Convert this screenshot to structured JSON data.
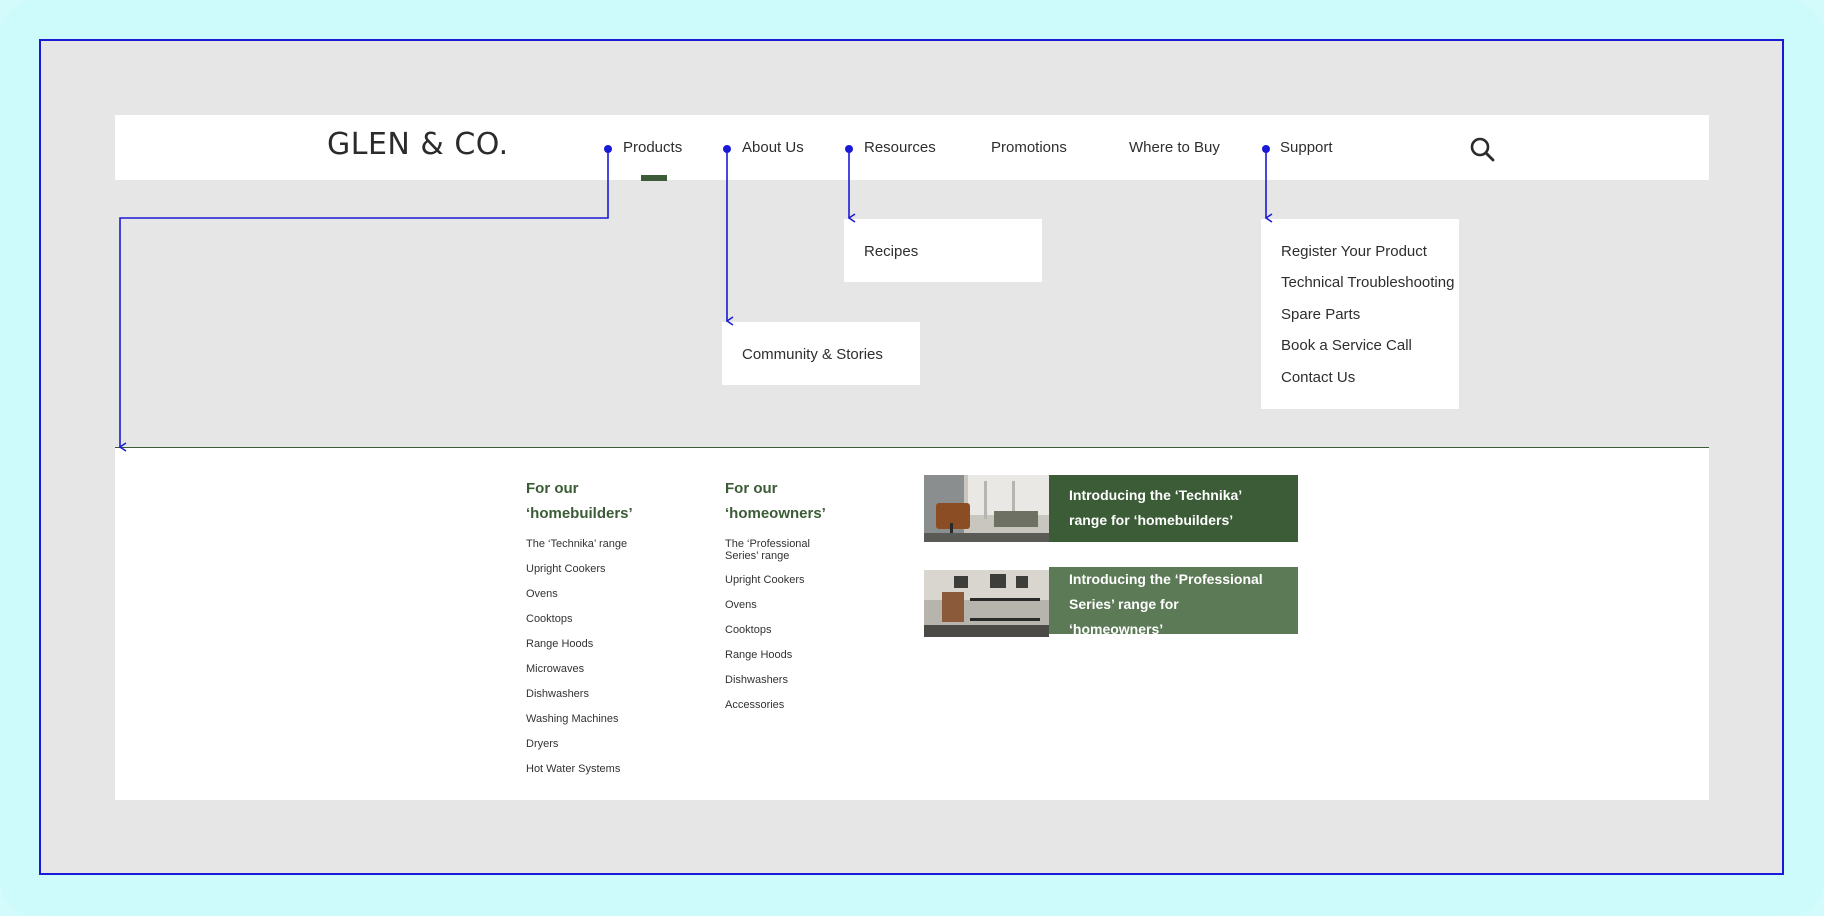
{
  "brand": {
    "logo": "GLEN & CO."
  },
  "nav": {
    "products": "Products",
    "about": "About Us",
    "resources": "Resources",
    "promotions": "Promotions",
    "where_to_buy": "Where to Buy",
    "support": "Support"
  },
  "dropdowns": {
    "resources": [
      "Recipes"
    ],
    "about": [
      "Community & Stories"
    ],
    "support": [
      "Register Your Product",
      "Technical Troubleshooting",
      "Spare Parts",
      "Book a Service Call",
      "Contact Us"
    ]
  },
  "mega_menu": {
    "homebuilders": {
      "heading_line1": "For our",
      "heading_line2": "‘homebuilders’",
      "links": [
        "The ‘Technika’ range",
        "Upright Cookers",
        "Ovens",
        "Cooktops",
        "Range Hoods",
        "Microwaves",
        "Dishwashers",
        "Washing Machines",
        "Dryers",
        "Hot Water Systems"
      ]
    },
    "homeowners": {
      "heading_line1": "For our",
      "heading_line2": "‘homeowners’",
      "links_first_line": "The ‘Professional",
      "links_second_line": "Series’ range",
      "links": [
        "Upright Cookers",
        "Ovens",
        "Cooktops",
        "Range Hoods",
        "Dishwashers",
        "Accessories"
      ]
    },
    "promos": [
      {
        "line1": "Introducing the ‘Technika’",
        "line2": "range for ‘homebuilders’",
        "color": "#3b5c36"
      },
      {
        "line1": "Introducing the ‘Professional",
        "line2": "Series’ range for",
        "line3": "‘homeowners’",
        "color": "#5c7a56"
      }
    ]
  },
  "colors": {
    "accent": "#3b5c36",
    "connector": "#1a1ad6",
    "canvas": "#e6e6e6"
  }
}
